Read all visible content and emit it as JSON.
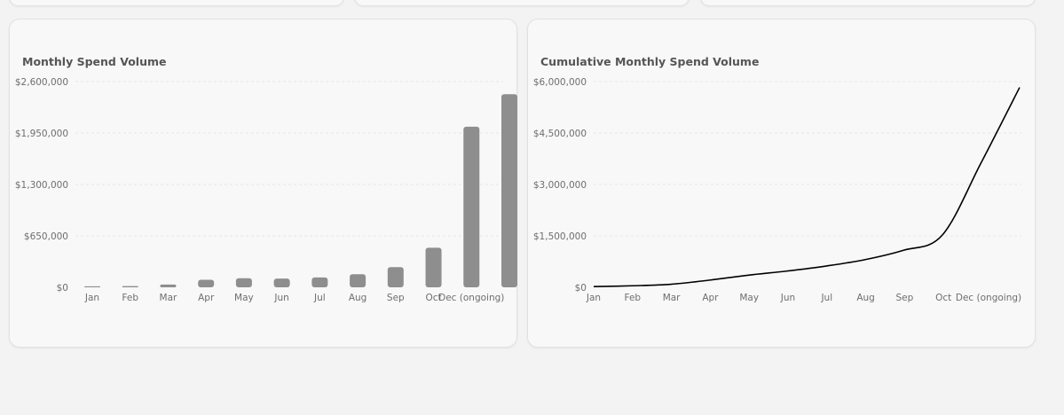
{
  "colors": {
    "bar": "#8e8e8e",
    "line": "#000000",
    "grid": "#e6e6e6",
    "card_bg": "#f8f8f8",
    "page_bg": "#f3f3f3"
  },
  "chart_data": [
    {
      "type": "bar",
      "title": "Monthly Spend Volume",
      "xlabel": "",
      "ylabel": "",
      "categories": [
        "Jan",
        "Feb",
        "Mar",
        "Apr",
        "May",
        "Jun",
        "Jul",
        "Aug",
        "Sep",
        "Oct",
        "Dec (ongoing)"
      ],
      "series": [
        {
          "values": [
            12000,
            15000,
            35000,
            95000,
            115000,
            110000,
            125000,
            165000,
            255000,
            500000,
            2030000,
            2440000
          ]
        }
      ],
      "ylim": [
        0,
        2600000
      ],
      "yticks": [
        0,
        650000,
        1300000,
        1950000,
        2600000
      ],
      "ytick_labels": [
        "$0",
        "$650,000",
        "$1,300,000",
        "$1,950,000",
        "$2,600,000"
      ],
      "grid": true
    },
    {
      "type": "line",
      "title": "Cumulative Monthly Spend Volume",
      "xlabel": "",
      "ylabel": "",
      "categories": [
        "Jan",
        "Feb",
        "Mar",
        "Apr",
        "May",
        "Jun",
        "Jul",
        "Aug",
        "Sep",
        "Oct",
        "Dec (ongoing)"
      ],
      "series": [
        {
          "values": [
            20000,
            45000,
            90000,
            210000,
            355000,
            475000,
            620000,
            805000,
            1080000,
            1520000,
            3620000,
            5830000
          ]
        }
      ],
      "ylim": [
        0,
        6000000
      ],
      "yticks": [
        0,
        1500000,
        3000000,
        4500000,
        6000000
      ],
      "ytick_labels": [
        "$0",
        "$1,500,000",
        "$3,000,000",
        "$4,500,000",
        "$6,000,000"
      ],
      "grid": true
    }
  ]
}
